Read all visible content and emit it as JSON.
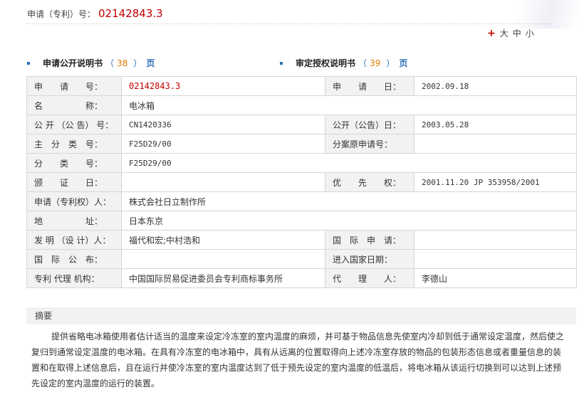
{
  "header": {
    "label": "申请（专利）号：",
    "number": "02142843.3"
  },
  "font_size": {
    "sizes": [
      "大",
      "中",
      "小"
    ]
  },
  "sections": [
    {
      "title": "申请公开说明书",
      "open": "（",
      "count": "38",
      "close": "）",
      "unit": "页"
    },
    {
      "title": "审定授权说明书",
      "open": "（",
      "count": "39",
      "close": "）",
      "unit": "页"
    }
  ],
  "table": {
    "application_no_label": "申　　请　　号：",
    "application_no": "02142843.3",
    "application_date_label": "申　　请　　日：",
    "application_date": "2002.09.18",
    "name_label": "名　　　　　称：",
    "name": "电冰箱",
    "pub_no_label": "公 开 （公 告） 号：",
    "pub_no": "CN1420336",
    "pub_date_label": "公开（公告）日：",
    "pub_date": "2003.05.28",
    "main_class_label": "主　分　类　号：",
    "main_class": "F25D29/00",
    "divisional_label": "分案原申请号：",
    "divisional": "",
    "class_label": "分　　类　　号：",
    "class": "F25D29/00",
    "cert_date_label": "颁　　证　　日：",
    "cert_date": "",
    "priority_label": "优　　先　　权：",
    "priority": "2001.11.20 JP 353958/2001",
    "applicant_label": "申请（专利权）人：",
    "applicant": "株式会社日立制作所",
    "address_label": "地　　　　　址：",
    "address": "日本东京",
    "inventor_label": "发 明 （设 计）人：",
    "inventor": "福代和宏;中村浩和",
    "intl_app_label": "国　际　申　请：",
    "intl_app": "",
    "intl_pub_label": "国　际　公　布：",
    "intl_pub": "",
    "national_date_label": "进入国家日期：",
    "national_date": "",
    "agency_label": "专利 代理 机构：",
    "agency": "中国国际贸易促进委员会专利商标事务所",
    "agent_label": "代　　理　　人：",
    "agent": "李德山"
  },
  "abstract": {
    "heading": "摘要",
    "text": "提供省略电冰箱使用者估计适当的温度来设定冷冻室的室内温度的麻烦，并可基于物品信息先使室内冷却到低于通常设定温度，然后使之复归到通常设定温度的电冰箱。在具有冷冻室的电冰箱中，具有从远离的位置取得向上述冷冻室存放的物品的包装形态信息或者重量信息的装置和在取得上述信息后，且在运行并使冷冻室的室内温度达到了低于预先设定的室内温度的低温后，将电冰箱从该运行切换到可以达到上述预先设定的室内温度的运行的装置。"
  }
}
